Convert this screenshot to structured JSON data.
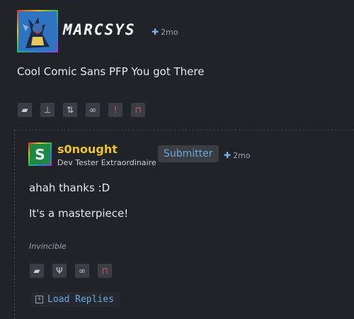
{
  "op": {
    "username": "MARCSYS",
    "time": "2mo",
    "body": "Cool Comic Sans PFP You got There",
    "avatar_icon": "blue-creature-avatar",
    "actions": [
      {
        "name": "reply-icon",
        "glyph": "💬"
      },
      {
        "name": "stamp-icon",
        "glyph": "⊥"
      },
      {
        "name": "transfer-icon",
        "glyph": "⇅"
      },
      {
        "name": "link-icon",
        "glyph": "⚭"
      },
      {
        "name": "report-icon",
        "glyph": "!"
      },
      {
        "name": "delete-icon",
        "glyph": "🗑"
      }
    ]
  },
  "reply": {
    "avatar_letter": "S",
    "username": "s0nought",
    "title": "Dev Tester Extraordinaire",
    "badge": "Submitter",
    "time": "2mo",
    "line1": "ahah thanks :D",
    "line2": "It's a masterpiece!",
    "signature": "Invincible",
    "actions": [
      {
        "name": "reply-icon",
        "glyph": "💬"
      },
      {
        "name": "wrench-icon",
        "glyph": "Ψ"
      },
      {
        "name": "link-icon",
        "glyph": "⚭"
      },
      {
        "name": "delete-icon",
        "glyph": "🗑"
      }
    ],
    "load_replies": "Load Replies"
  },
  "colors": {
    "background": "#202328",
    "accent_blue": "#6aa8dc",
    "username_gold": "#f0c419",
    "danger": "#d65a5a"
  }
}
